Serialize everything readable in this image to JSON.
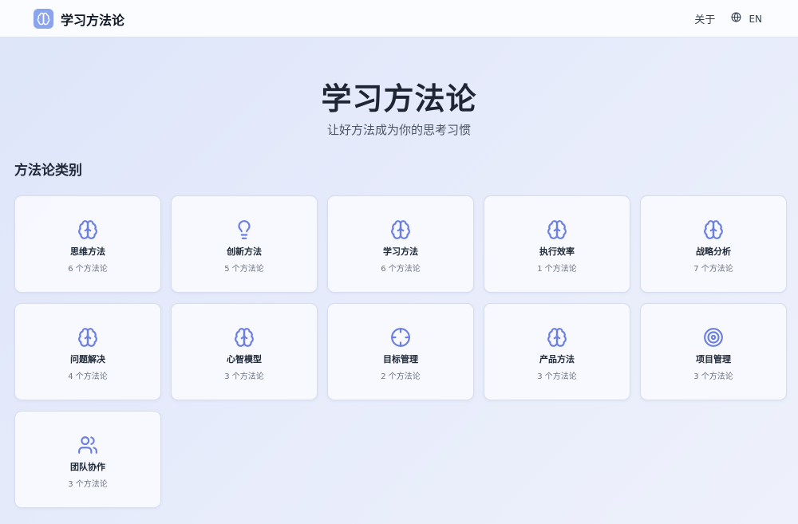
{
  "header": {
    "brand": "学习方法论",
    "about": "关于",
    "lang": "EN"
  },
  "hero": {
    "title": "学习方法论",
    "subtitle": "让好方法成为你的思考习惯"
  },
  "section_title": "方法论类别",
  "colors": {
    "accent": "#6b7fe0",
    "logo_bg": "#8aa4ee"
  },
  "categories": [
    {
      "icon": "brain-icon",
      "title": "思维方法",
      "count": "6 个方法论"
    },
    {
      "icon": "lightbulb-icon",
      "title": "创新方法",
      "count": "5 个方法论"
    },
    {
      "icon": "brain-icon",
      "title": "学习方法",
      "count": "6 个方法论"
    },
    {
      "icon": "brain-icon",
      "title": "执行效率",
      "count": "1 个方法论"
    },
    {
      "icon": "brain-icon",
      "title": "战略分析",
      "count": "7 个方法论"
    },
    {
      "icon": "brain-icon",
      "title": "问题解决",
      "count": "4 个方法论"
    },
    {
      "icon": "brain-icon",
      "title": "心智模型",
      "count": "3 个方法论"
    },
    {
      "icon": "crosshair-icon",
      "title": "目标管理",
      "count": "2 个方法论"
    },
    {
      "icon": "brain-icon",
      "title": "产品方法",
      "count": "3 个方法论"
    },
    {
      "icon": "target-icon",
      "title": "项目管理",
      "count": "3 个方法论"
    },
    {
      "icon": "users-icon",
      "title": "团队协作",
      "count": "3 个方法论"
    }
  ]
}
